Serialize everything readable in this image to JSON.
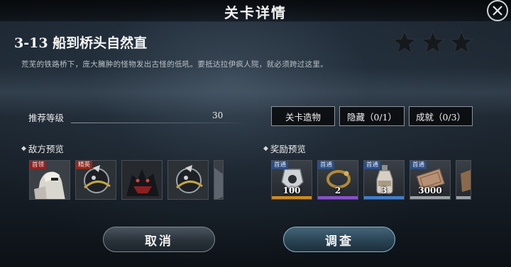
{
  "header": {
    "title": "关卡详情"
  },
  "stage": {
    "title": "3-13 船到桥头自然直",
    "description": "荒芜的铁路桥下，庞大臃肿的怪物发出古怪的低吼。要抵达拉伊疯人院，就必须跨过这里。",
    "stars_earned": 0,
    "stars_total": 3
  },
  "recommended": {
    "label": "推荐等级",
    "value": "30"
  },
  "tabs": [
    {
      "label": "关卡造物"
    },
    {
      "label": "隐藏（0/1）"
    },
    {
      "label": "成就（0/3）"
    }
  ],
  "enemies": {
    "label": "敌方预览",
    "items": [
      {
        "tag": "首领",
        "icon": "enemy-boss-icon"
      },
      {
        "tag": "精英",
        "icon": "enemy-orb-icon"
      },
      {
        "tag": "",
        "icon": "enemy-beast-icon"
      },
      {
        "tag": "",
        "icon": "enemy-orb-icon"
      },
      {
        "tag": "",
        "icon": "enemy-partial-icon"
      }
    ]
  },
  "rewards": {
    "label": "奖励预览",
    "items": [
      {
        "tag": "首通",
        "qty": "100",
        "icon": "crest-icon",
        "rarity_color": "#d08a1a"
      },
      {
        "tag": "首通",
        "qty": "2",
        "icon": "ring-icon",
        "rarity_color": "#8a4fd0"
      },
      {
        "tag": "首通",
        "qty": "3",
        "icon": "potion-icon",
        "rarity_color": "#3f7fd0"
      },
      {
        "tag": "首通",
        "qty": "3000",
        "icon": "ticket-icon",
        "rarity_color": "#9aa0a6"
      },
      {
        "tag": "",
        "qty": "",
        "icon": "partial-reward-icon",
        "rarity_color": "#9aa0a6"
      }
    ]
  },
  "buttons": {
    "cancel": "取消",
    "investigate": "调查"
  }
}
